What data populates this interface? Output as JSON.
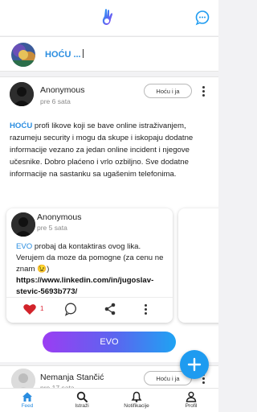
{
  "header": {
    "logo_icon": "app-logo-icon",
    "chat_icon": "chat-bubble-icon",
    "accent_color": "#2a8de0"
  },
  "compose": {
    "text": "HOĆU ..."
  },
  "post": {
    "author": "Anonymous",
    "time": "pre 6 sata",
    "follow_label": "Hoću i ja",
    "body_highlight": "HOĆU",
    "body_text": " profi likove koji se bave online istraživanjem, razumeju security i mogu da skupe i iskopaju dodatne informacije vezano za jedan online incident i njegove učesnike. Dobro plaćeno i vrlo ozbiljno. Sve dodatne informacije na sastanku sa ugašenim telefonima.",
    "shared": {
      "author": "Anonymous",
      "time": "pre 5 sata",
      "body_highlight": "EVO",
      "body_text": " probaj da kontaktiras ovog lika. Verujem da moze da pomogne (za cenu ne znam 😉) ",
      "link": "https://www.linkedin.com/in/jugoslav-stevic-5693b773/",
      "likes": "1"
    },
    "reply_button": "EVO"
  },
  "next_post": {
    "author": "Nemanja Stančić",
    "time": "pre 17 sata",
    "follow_label": "Hoću i ja"
  },
  "nav": [
    {
      "label": "Feed",
      "icon": "home-icon",
      "active": true
    },
    {
      "label": "Istraži",
      "icon": "search-icon",
      "active": false
    },
    {
      "label": "Notifikacije",
      "icon": "bell-icon",
      "active": false
    },
    {
      "label": "Profil",
      "icon": "person-icon",
      "active": false
    }
  ]
}
